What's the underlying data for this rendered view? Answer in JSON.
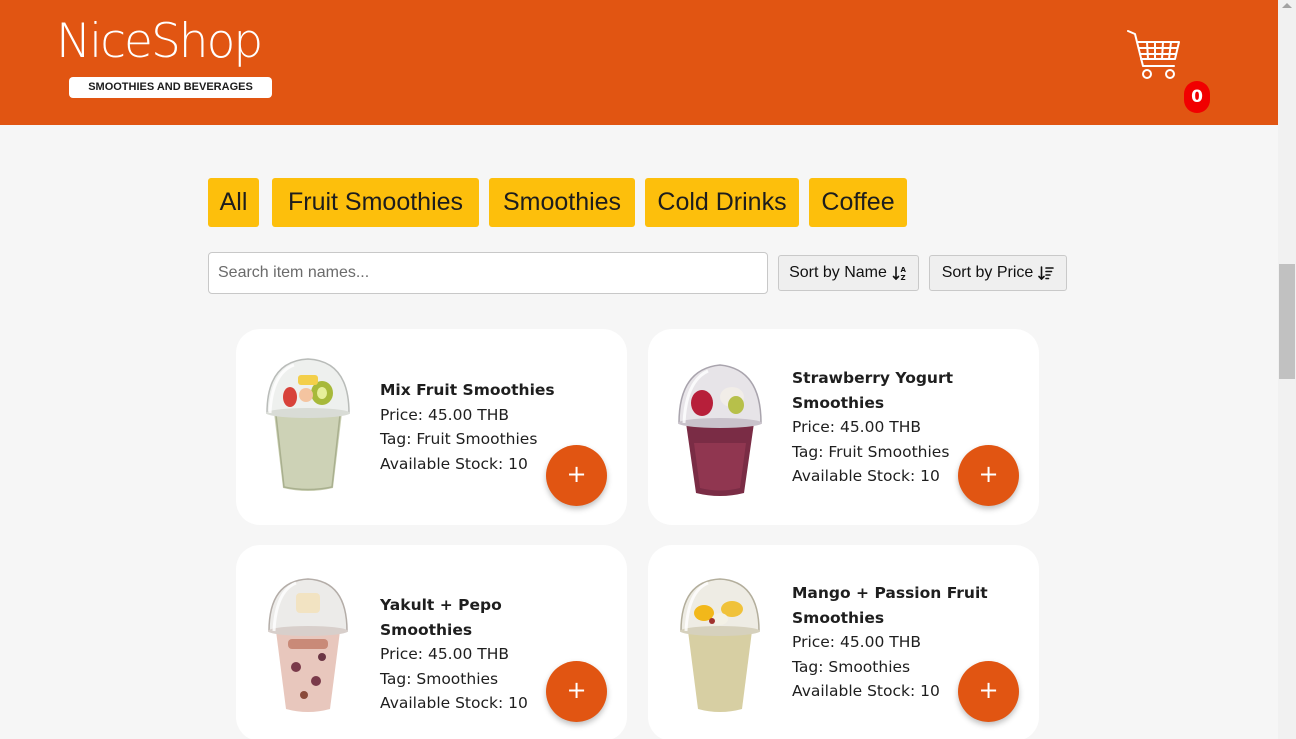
{
  "brand": {
    "name": "NiceShop",
    "tagline": "SMOOTHIES AND BEVERAGES",
    "primary_color": "#e15512",
    "accent_color": "#fdbf0c"
  },
  "cart": {
    "icon": "shopping-cart-icon",
    "count": "0"
  },
  "filters": [
    "All",
    "Fruit Smoothies",
    "Smoothies",
    "Cold Drinks",
    "Coffee"
  ],
  "search": {
    "placeholder": "Search item names...",
    "value": ""
  },
  "sort": {
    "by_name": "Sort by Name",
    "by_price": "Sort by Price"
  },
  "add_label": "+",
  "products": [
    {
      "name": "Mix Fruit Smoothies",
      "price": "Price: 45.00 THB",
      "tag": "Tag: Fruit Smoothies",
      "stock": "Available Stock: 10"
    },
    {
      "name": "Strawberry Yogurt Smoothies",
      "price": "Price: 45.00 THB",
      "tag": "Tag: Fruit Smoothies",
      "stock": "Available Stock: 10"
    },
    {
      "name": "Yakult + Pepo Smoothies",
      "price": "Price: 45.00 THB",
      "tag": "Tag: Smoothies",
      "stock": "Available Stock: 10"
    },
    {
      "name": "Mango + Passion Fruit Smoothies",
      "price": "Price: 45.00 THB",
      "tag": "Tag: Smoothies",
      "stock": "Available Stock: 10"
    }
  ]
}
